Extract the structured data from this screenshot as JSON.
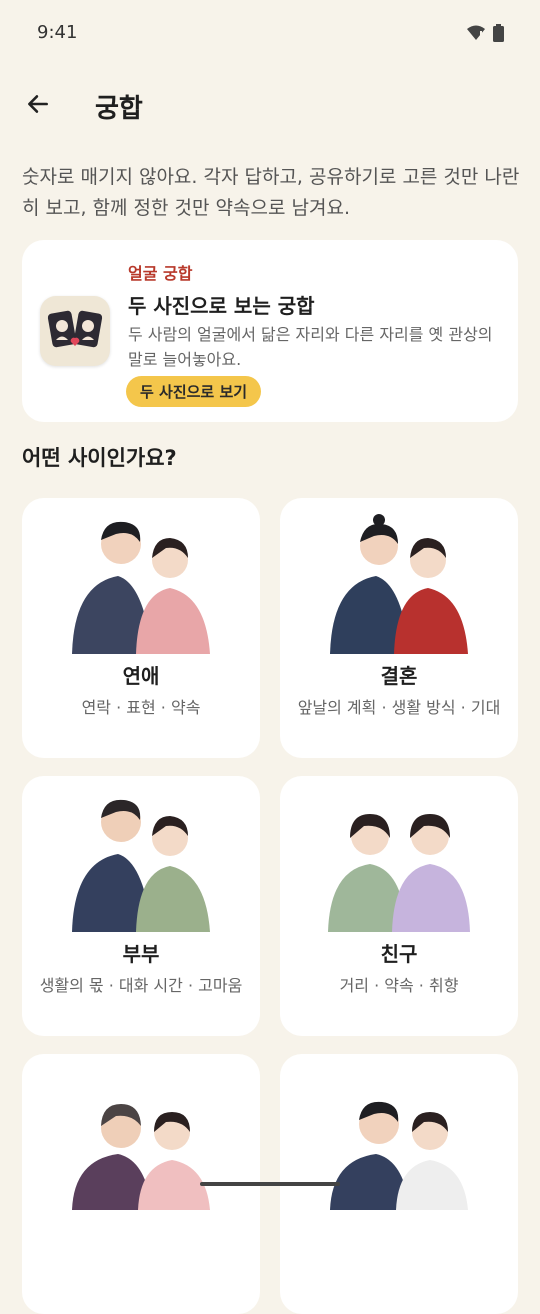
{
  "status": {
    "time": "9:41"
  },
  "header": {
    "title": "궁합"
  },
  "intro": "숫자로 매기지 않아요. 각자 답하고, 공유하기로 고른 것만 나란히 보고, 함께 정한 것만 약속으로 남겨요.",
  "face_card": {
    "eyebrow": "얼굴 궁합",
    "title": "두 사진으로 보는 궁합",
    "description": "두 사람의 얼굴에서 닮은 자리와 다른 자리를 옛 관상의 말로 늘어놓아요.",
    "cta": "두 사진으로 보기"
  },
  "section_heading": "어떤 사이인가요?",
  "relations": [
    {
      "name": "연애",
      "sub": "연락 · 표현 · 약속",
      "left": "#3c4560",
      "right": "#e8a6a8",
      "icon": "couple-dating-illustration"
    },
    {
      "name": "결혼",
      "sub": "앞날의 계획 · 생활 방식 · 기대",
      "left": "#2f3f5c",
      "right": "#b8312e",
      "icon": "couple-wedding-illustration"
    },
    {
      "name": "부부",
      "sub": "생활의 몫 · 대화 시간 · 고마움",
      "left": "#34405e",
      "right": "#9bb08c",
      "icon": "married-couple-illustration"
    },
    {
      "name": "친구",
      "sub": "거리 · 약속 · 취향",
      "left": "#9fb79a",
      "right": "#c6b4dd",
      "icon": "friends-illustration"
    },
    {
      "name": "",
      "sub": "",
      "left": "#5a3f5c",
      "right": "#f0bfc0",
      "icon": "parent-child-illustration"
    },
    {
      "name": "",
      "sub": "",
      "left": "#34405e",
      "right": "#eeeeee",
      "icon": "couple-illustration"
    }
  ]
}
